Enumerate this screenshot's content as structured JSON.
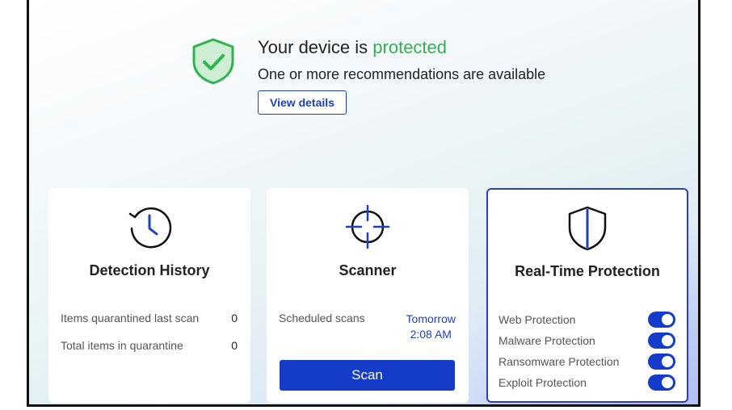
{
  "status": {
    "headline_prefix": "Your device is ",
    "headline_status": "protected",
    "subtext": "One or more recommendations are available",
    "view_details_label": "View details",
    "status_color": "#2fb34f"
  },
  "cards": {
    "detection_history": {
      "title": "Detection History",
      "icon": "clock-history-icon",
      "rows": [
        {
          "label": "Items quarantined last scan",
          "value": "0"
        },
        {
          "label": "Total items in quarantine",
          "value": "0"
        }
      ]
    },
    "scanner": {
      "title": "Scanner",
      "icon": "crosshair-icon",
      "scheduled_label": "Scheduled scans",
      "scheduled_day": "Tomorrow",
      "scheduled_time": "2:08 AM",
      "scan_button_label": "Scan"
    },
    "real_time_protection": {
      "title": "Real-Time Protection",
      "icon": "shield-half-icon",
      "items": [
        {
          "label": "Web Protection",
          "enabled": true
        },
        {
          "label": "Malware Protection",
          "enabled": true
        },
        {
          "label": "Ransomware Protection",
          "enabled": true
        },
        {
          "label": "Exploit Protection",
          "enabled": true
        }
      ]
    }
  },
  "colors": {
    "accent": "#143cc8",
    "protected_green": "#2fb34f"
  }
}
